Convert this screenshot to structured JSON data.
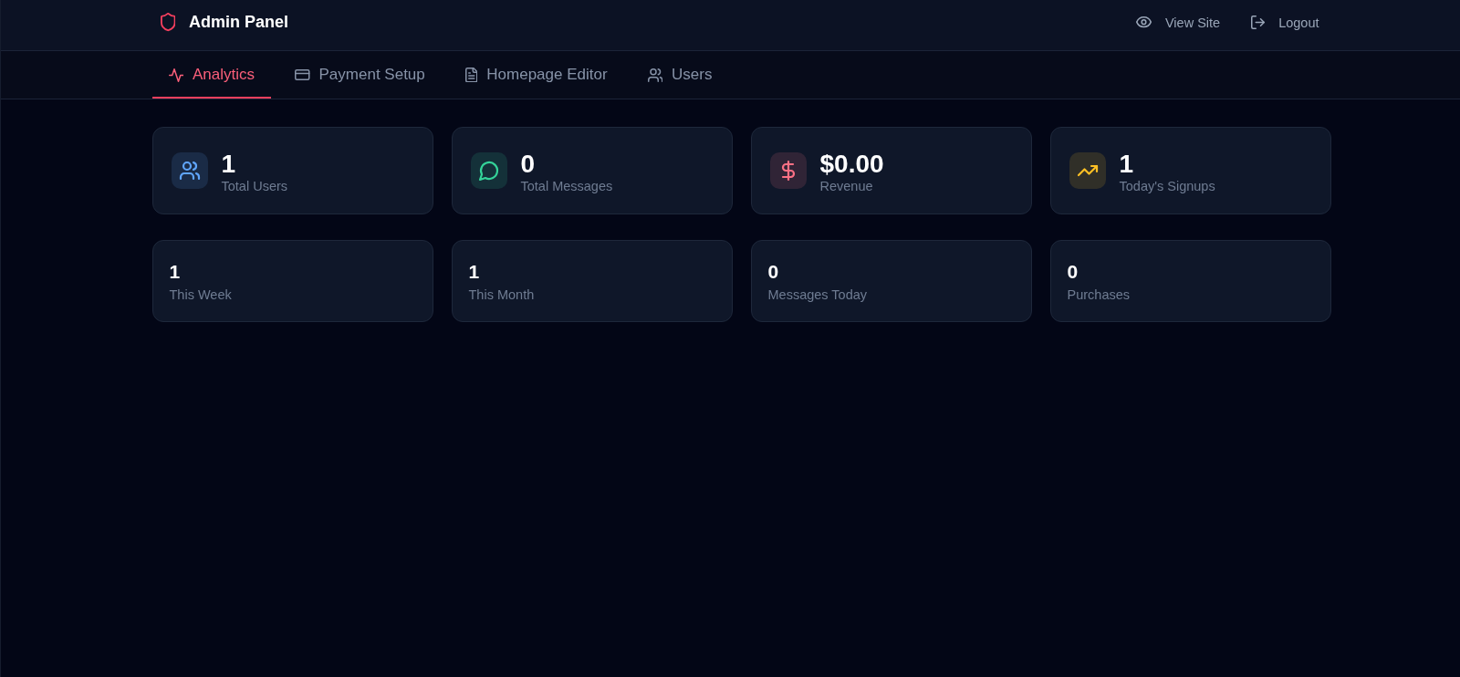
{
  "header": {
    "title": "Admin Panel",
    "actions": [
      {
        "label": "View Site"
      },
      {
        "label": "Logout"
      }
    ]
  },
  "tabs": [
    {
      "label": "Analytics",
      "selected": true
    },
    {
      "label": "Payment Setup",
      "selected": false
    },
    {
      "label": "Homepage Editor",
      "selected": false
    },
    {
      "label": "Users",
      "selected": false
    }
  ],
  "stats": [
    {
      "value": "1",
      "label": "Total Users",
      "color": "#60a5fa"
    },
    {
      "value": "0",
      "label": "Total Messages",
      "color": "#34d399"
    },
    {
      "value": "$0.00",
      "label": "Revenue",
      "color": "#fb7185"
    },
    {
      "value": "1",
      "label": "Today's Signups",
      "color": "#fbbf24"
    }
  ],
  "summary": [
    {
      "value": "1",
      "label": "This Week"
    },
    {
      "value": "1",
      "label": "This Month"
    },
    {
      "value": "0",
      "label": "Messages Today"
    },
    {
      "value": "0",
      "label": "Purchases"
    }
  ]
}
